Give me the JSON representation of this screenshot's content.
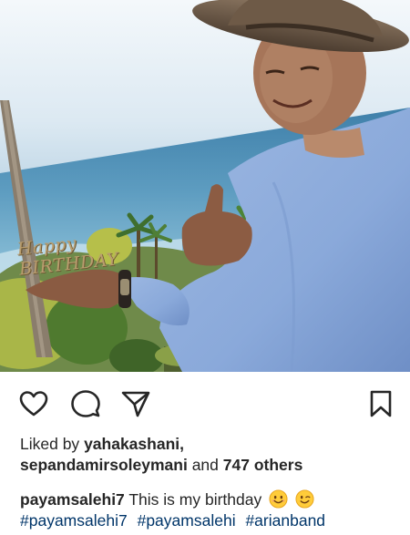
{
  "post": {
    "photo": {
      "cake_topper_text": "Happy BIRTHDAY"
    },
    "actions": {
      "like_icon": "heart-outline-icon",
      "comment_icon": "comment-bubble-icon",
      "share_icon": "paper-plane-icon",
      "save_icon": "bookmark-icon"
    },
    "likes": {
      "prefix": "Liked by",
      "user1": "yahakashani,",
      "user2": "sepandamirsoleymani",
      "and": "and",
      "others": "747 others"
    },
    "caption": {
      "username": "payamsalehi7",
      "text": "This is my birthday",
      "emojis": [
        "smiling-face-emoji",
        "winking-face-emoji"
      ],
      "hashtags": [
        "#payamsalehi7",
        "#payamsalehi",
        "#arianband"
      ]
    }
  }
}
